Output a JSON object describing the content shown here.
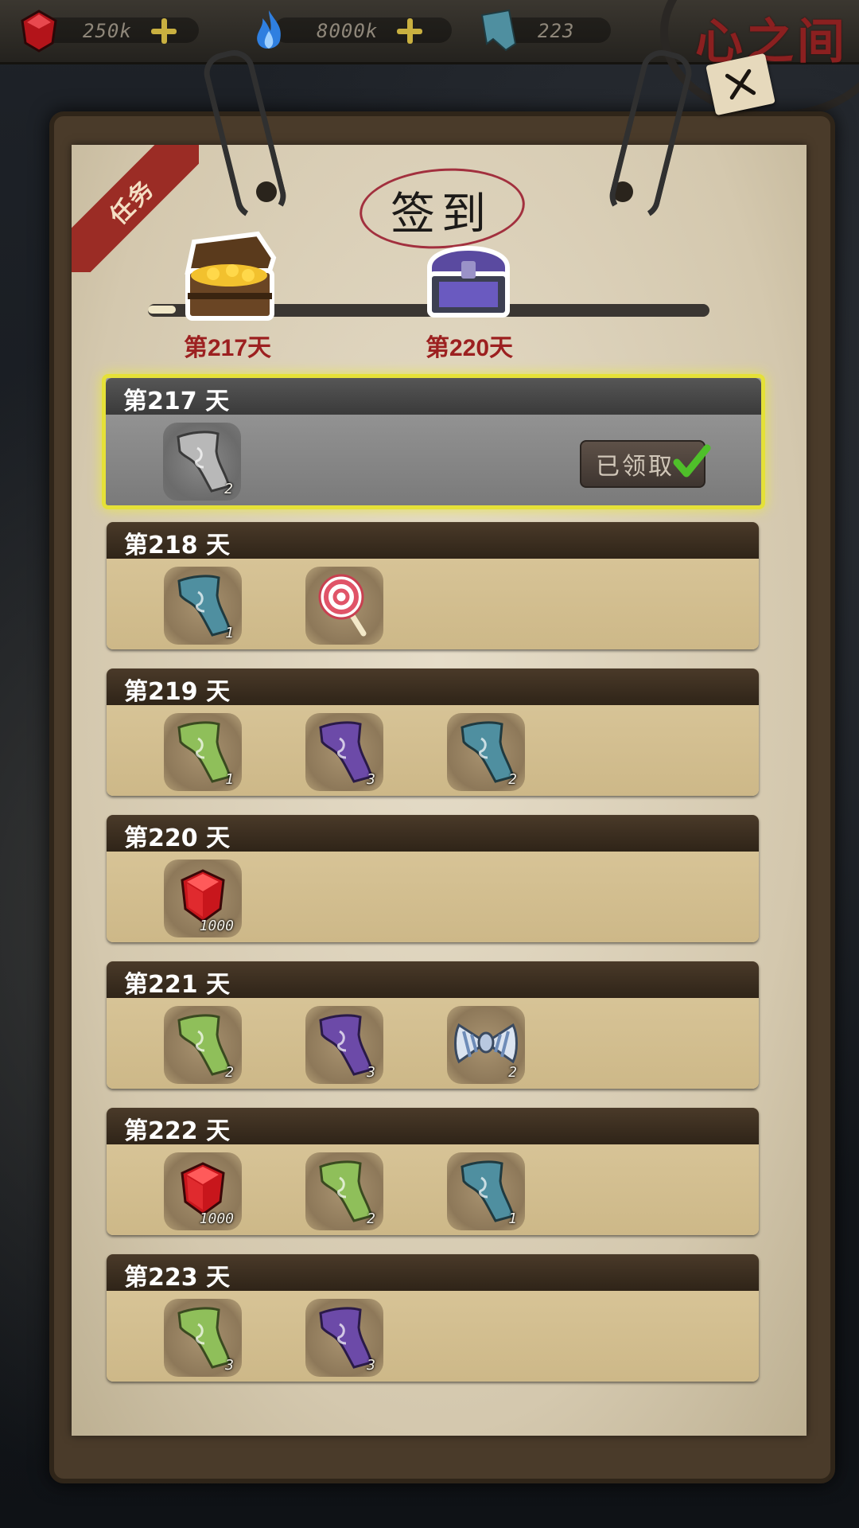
{
  "resources": [
    {
      "icon": "red-gem-icon",
      "value": "250k"
    },
    {
      "icon": "blue-flame-icon",
      "value": "8000k"
    },
    {
      "icon": "talisman-icon",
      "value": "223"
    }
  ],
  "header": {
    "logo_text": "心之间",
    "heading": "签到",
    "corner_tab": "任务"
  },
  "milestones": [
    {
      "prefix": "第",
      "day": "217",
      "suffix": "天",
      "chest": "gold-treasure-chest"
    },
    {
      "prefix": "第",
      "day": "220",
      "suffix": "天",
      "chest": "purple-treasure-chest"
    }
  ],
  "progress_fraction": 0.05,
  "rows": [
    {
      "prefix": "第",
      "day": "217",
      "suffix": "天",
      "claimed": true,
      "claimed_label": "已领取",
      "items": [
        {
          "icon": "gray-talisman-icon",
          "qty": "2"
        }
      ]
    },
    {
      "prefix": "第",
      "day": "218",
      "suffix": "天",
      "claimed": false,
      "items": [
        {
          "icon": "teal-talisman-icon",
          "qty": "1"
        },
        {
          "icon": "lollipop-icon",
          "qty": ""
        }
      ]
    },
    {
      "prefix": "第",
      "day": "219",
      "suffix": "天",
      "claimed": false,
      "items": [
        {
          "icon": "green-talisman-icon",
          "qty": "1"
        },
        {
          "icon": "purple-talisman-icon",
          "qty": "3"
        },
        {
          "icon": "teal-talisman-icon",
          "qty": "2"
        }
      ]
    },
    {
      "prefix": "第",
      "day": "220",
      "suffix": "天",
      "claimed": false,
      "items": [
        {
          "icon": "red-gem-icon",
          "qty": "1000"
        }
      ]
    },
    {
      "prefix": "第",
      "day": "221",
      "suffix": "天",
      "claimed": false,
      "items": [
        {
          "icon": "green-talisman-icon",
          "qty": "2"
        },
        {
          "icon": "purple-talisman-icon",
          "qty": "3"
        },
        {
          "icon": "striped-bow-icon",
          "qty": "2"
        }
      ]
    },
    {
      "prefix": "第",
      "day": "222",
      "suffix": "天",
      "claimed": false,
      "items": [
        {
          "icon": "red-gem-icon",
          "qty": "1000"
        },
        {
          "icon": "green-talisman-icon",
          "qty": "2"
        },
        {
          "icon": "teal-talisman-icon",
          "qty": "1"
        }
      ]
    },
    {
      "prefix": "第",
      "day": "223",
      "suffix": "天",
      "claimed": false,
      "items": [
        {
          "icon": "green-talisman-icon",
          "qty": "3"
        },
        {
          "icon": "purple-talisman-icon",
          "qty": "3"
        }
      ]
    }
  ],
  "colors": {
    "accent_red": "#9c2020",
    "highlight_yellow": "#e5e138",
    "talisman_teal": "#4f8fa0",
    "talisman_green": "#8fbf5a",
    "talisman_purple": "#6c4aa8",
    "gem_red": "#c8161c"
  }
}
